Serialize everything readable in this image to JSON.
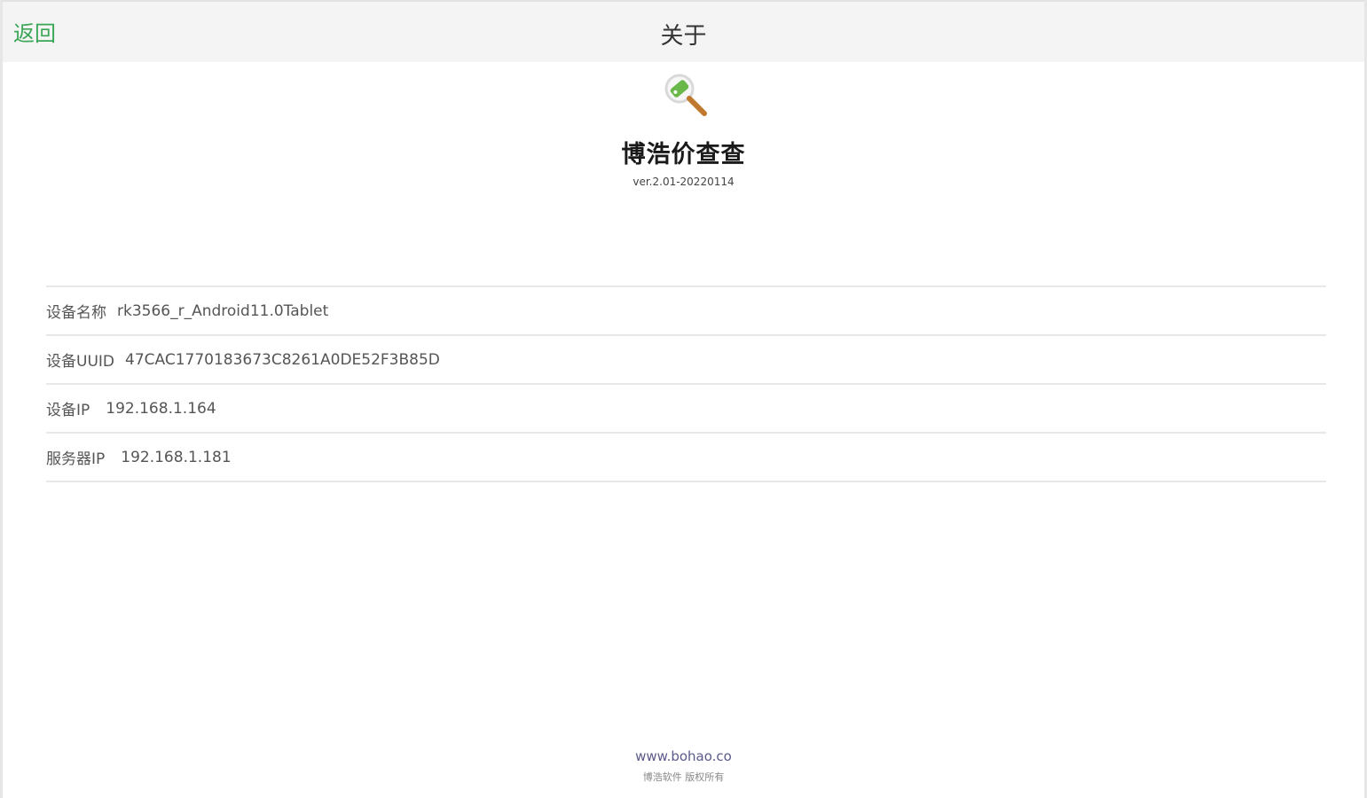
{
  "header": {
    "back_label": "返回",
    "title": "关于"
  },
  "app": {
    "icon": "magnifier-tag-icon",
    "name": "博浩价查查",
    "version": "ver.2.01-20220114"
  },
  "info": [
    {
      "label": "设备名称",
      "value": "rk3566_r_Android11.0Tablet"
    },
    {
      "label": "设备UUID",
      "value": "47CAC1770183673C8261A0DE52F3B85D"
    },
    {
      "label": "设备IP",
      "value": "192.168.1.164"
    },
    {
      "label": "服务器IP",
      "value": "192.168.1.181"
    }
  ],
  "footer": {
    "website": "www.bohao.co",
    "copyright": "博浩软件 版权所有"
  },
  "colors": {
    "accent": "#3aa655",
    "topbar_bg": "#f4f4f4",
    "divider": "#e8e8e8"
  }
}
